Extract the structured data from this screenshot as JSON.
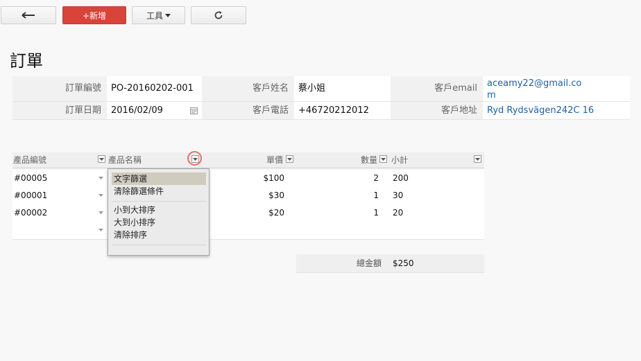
{
  "toolbar": {
    "back_icon": "arrow-left-icon",
    "new_label": "+新增",
    "tools_label": "工具",
    "refresh_icon": "refresh-icon"
  },
  "page_title": "訂單",
  "order": {
    "order_no_label": "訂單編號",
    "order_no": "PO-20160202-001",
    "customer_name_label": "客戶姓名",
    "customer_name": "蔡小姐",
    "email_label": "客戶email",
    "email_line1": "aceamy22@gmail.co",
    "email_line2": "m",
    "date_label": "訂單日期",
    "date": "2016/02/09",
    "phone_label": "客戶電話",
    "phone": "+46720212012",
    "address_label": "客戶地址",
    "address": "Ryd Rydsvägen242C 16"
  },
  "grid": {
    "columns": {
      "product_code": "產品編號",
      "product_name": "產品名稱",
      "unit_price": "單價",
      "quantity": "數量",
      "subtotal": "小計"
    },
    "rows": [
      {
        "product_code": "#00005",
        "unit_price": "$100",
        "quantity": "2",
        "subtotal": "200"
      },
      {
        "product_code": "#00001",
        "unit_price": "$30",
        "quantity": "1",
        "subtotal": "30"
      },
      {
        "product_code": "#00002",
        "unit_price": "$20",
        "quantity": "1",
        "subtotal": "20"
      }
    ],
    "total_label": "總金額",
    "total_value": "$250"
  },
  "dropdown_menu": {
    "items": [
      "文字篩選",
      "清除篩選條件",
      "小到大排序",
      "大到小排序",
      "清除排序"
    ],
    "highlighted": "文字篩選"
  },
  "colors": {
    "primary_button": "#d9443a",
    "link": "#1d5fa8",
    "highlight_ring": "#e8706b"
  }
}
